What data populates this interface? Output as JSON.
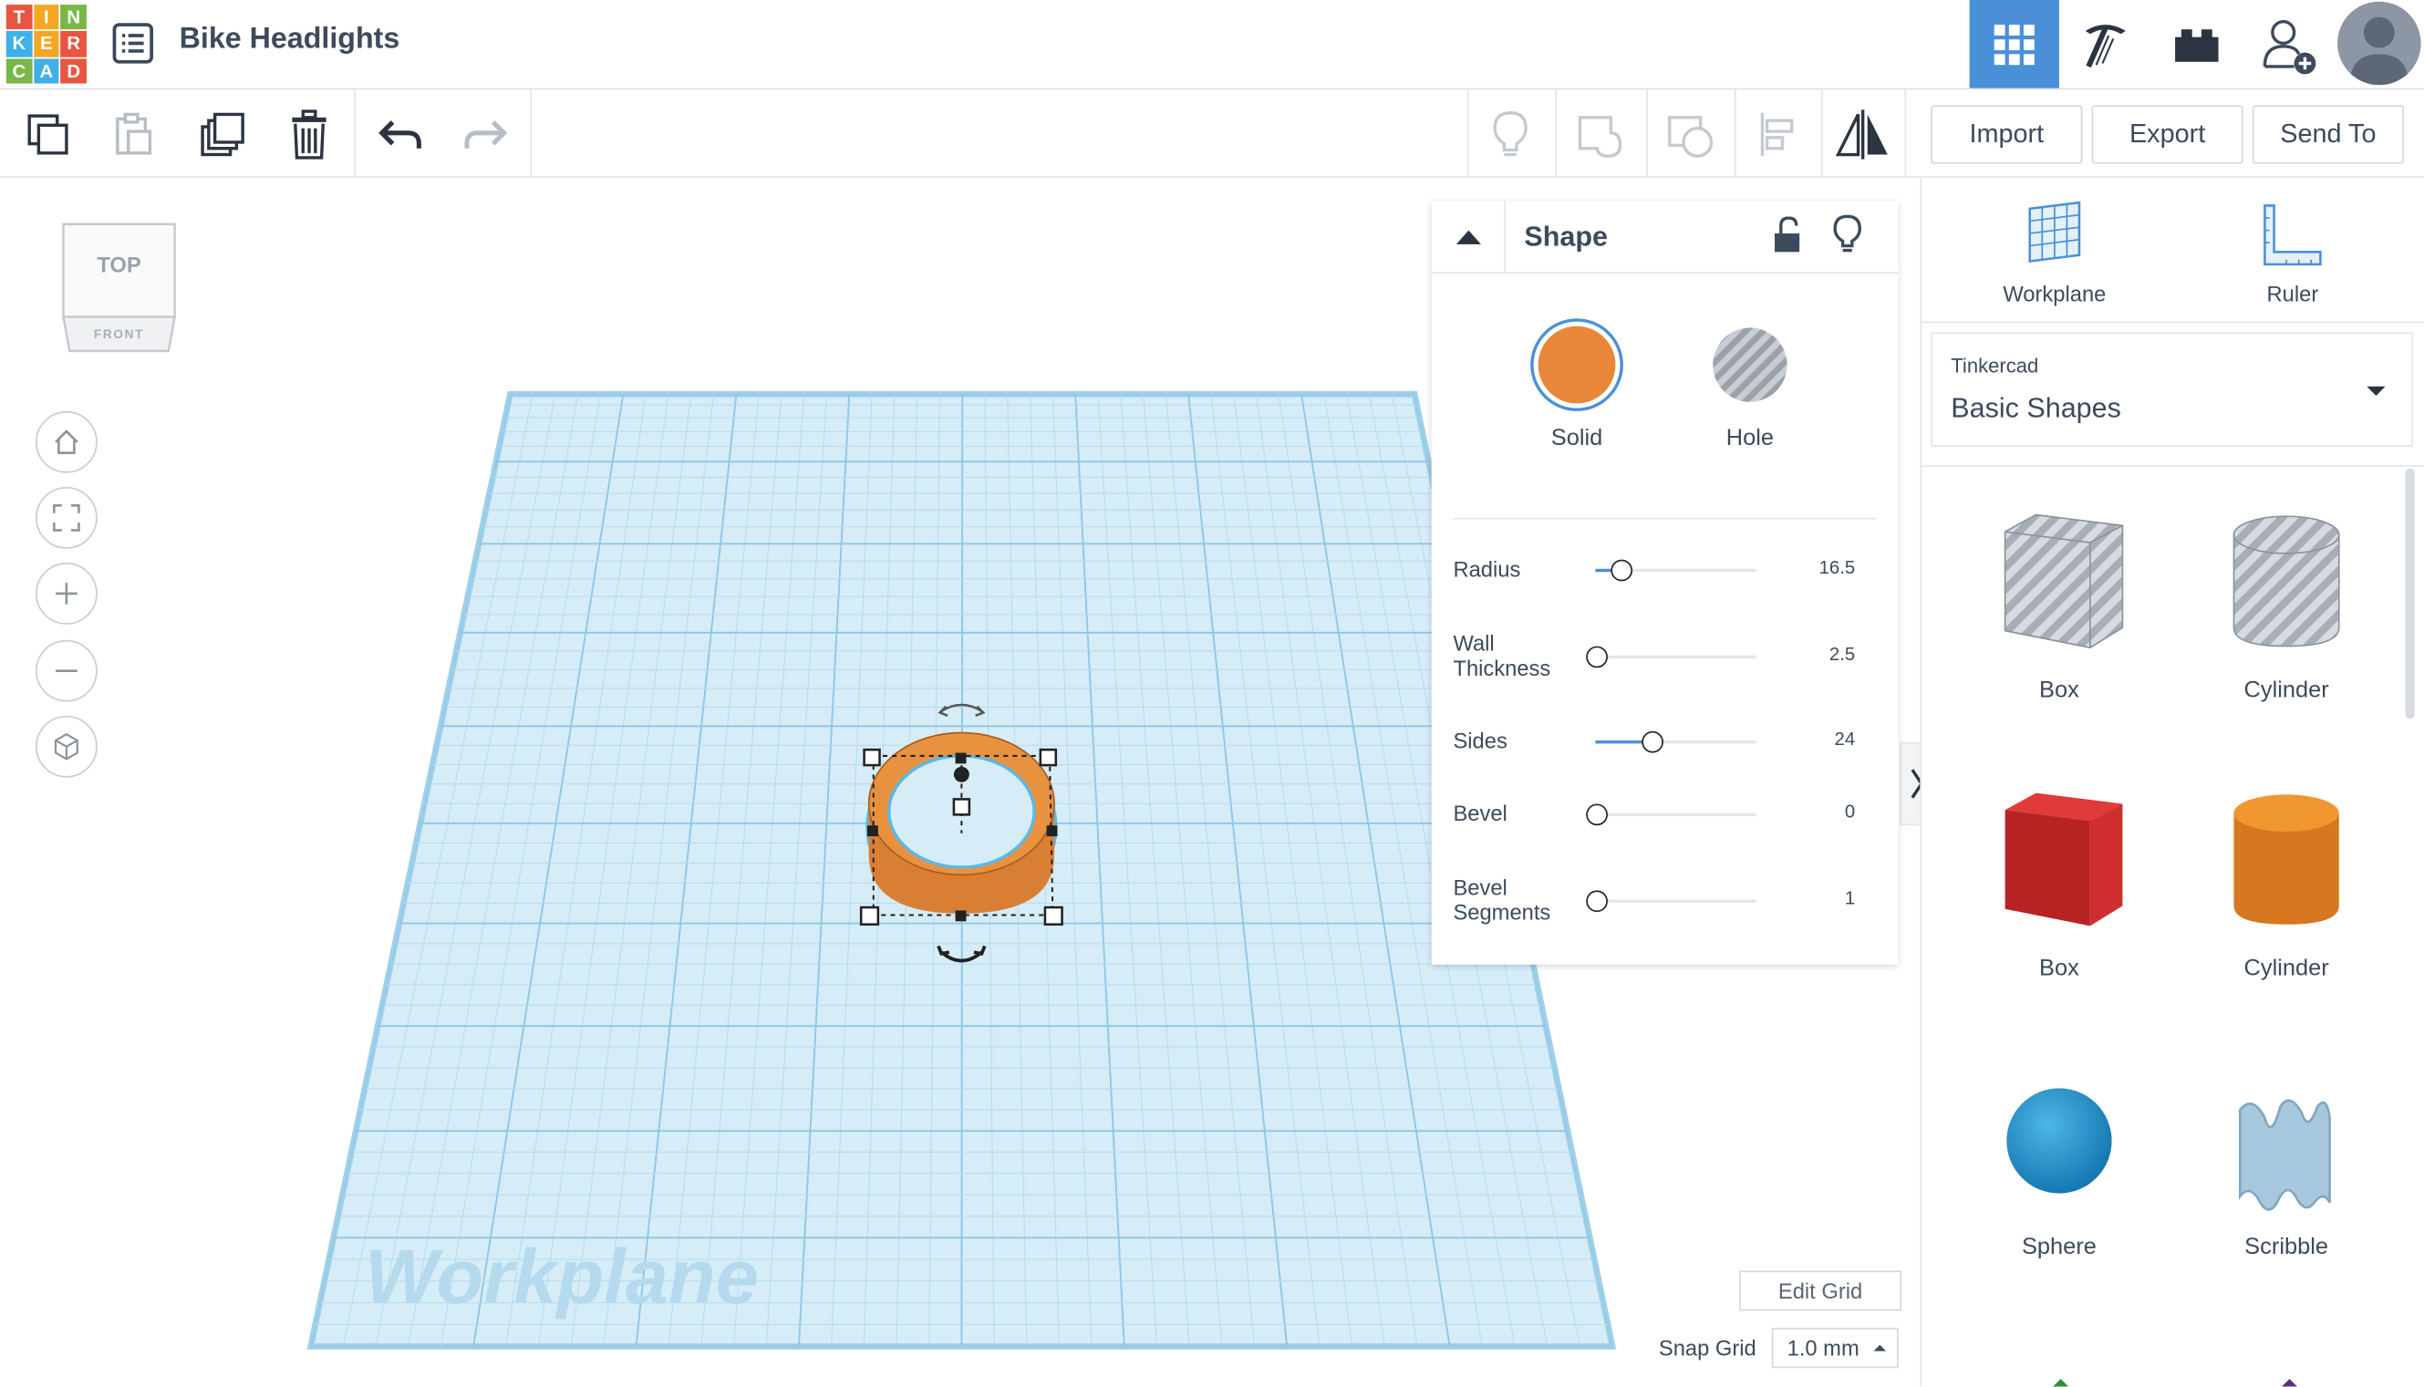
{
  "header": {
    "logo_letters": [
      "T",
      "I",
      "N",
      "K",
      "E",
      "R",
      "C",
      "A",
      "D"
    ],
    "logo_colors": [
      "#e8563f",
      "#f5a623",
      "#7ab648",
      "#3fb0e8",
      "#f5a623",
      "#e8563f",
      "#7ab648",
      "#3fb0e8",
      "#e8563f"
    ],
    "project_title": "Bike Headlights"
  },
  "toolbar": {
    "import_label": "Import",
    "export_label": "Export",
    "send_to_label": "Send To"
  },
  "viewcube": {
    "top_label": "TOP",
    "front_label": "FRONT"
  },
  "workplane": {
    "watermark": "Workplane",
    "edit_grid_label": "Edit Grid",
    "snap_grid_label": "Snap Grid",
    "snap_grid_value": "1.0 mm"
  },
  "inspector": {
    "title": "Shape",
    "solid_label": "Solid",
    "hole_label": "Hole",
    "solid_color": "#e8873a",
    "params": [
      {
        "label": "Radius",
        "value": "16.5",
        "fraction": 0.15
      },
      {
        "label": "Wall Thickness",
        "value": "2.5",
        "fraction": 0.0
      },
      {
        "label": "Sides",
        "value": "24",
        "fraction": 0.35
      },
      {
        "label": "Bevel",
        "value": "0",
        "fraction": 0.0
      },
      {
        "label": "Bevel Segments",
        "value": "1",
        "fraction": 0.0
      }
    ]
  },
  "right_panel": {
    "workplane_label": "Workplane",
    "ruler_label": "Ruler",
    "library_source": "Tinkercad",
    "library_name": "Basic Shapes",
    "shapes": [
      {
        "label": "Box",
        "kind": "box-hole"
      },
      {
        "label": "Cylinder",
        "kind": "cylinder-hole"
      },
      {
        "label": "Box",
        "kind": "box-solid"
      },
      {
        "label": "Cylinder",
        "kind": "cylinder-solid"
      },
      {
        "label": "Sphere",
        "kind": "sphere"
      },
      {
        "label": "Scribble",
        "kind": "scribble"
      }
    ]
  }
}
